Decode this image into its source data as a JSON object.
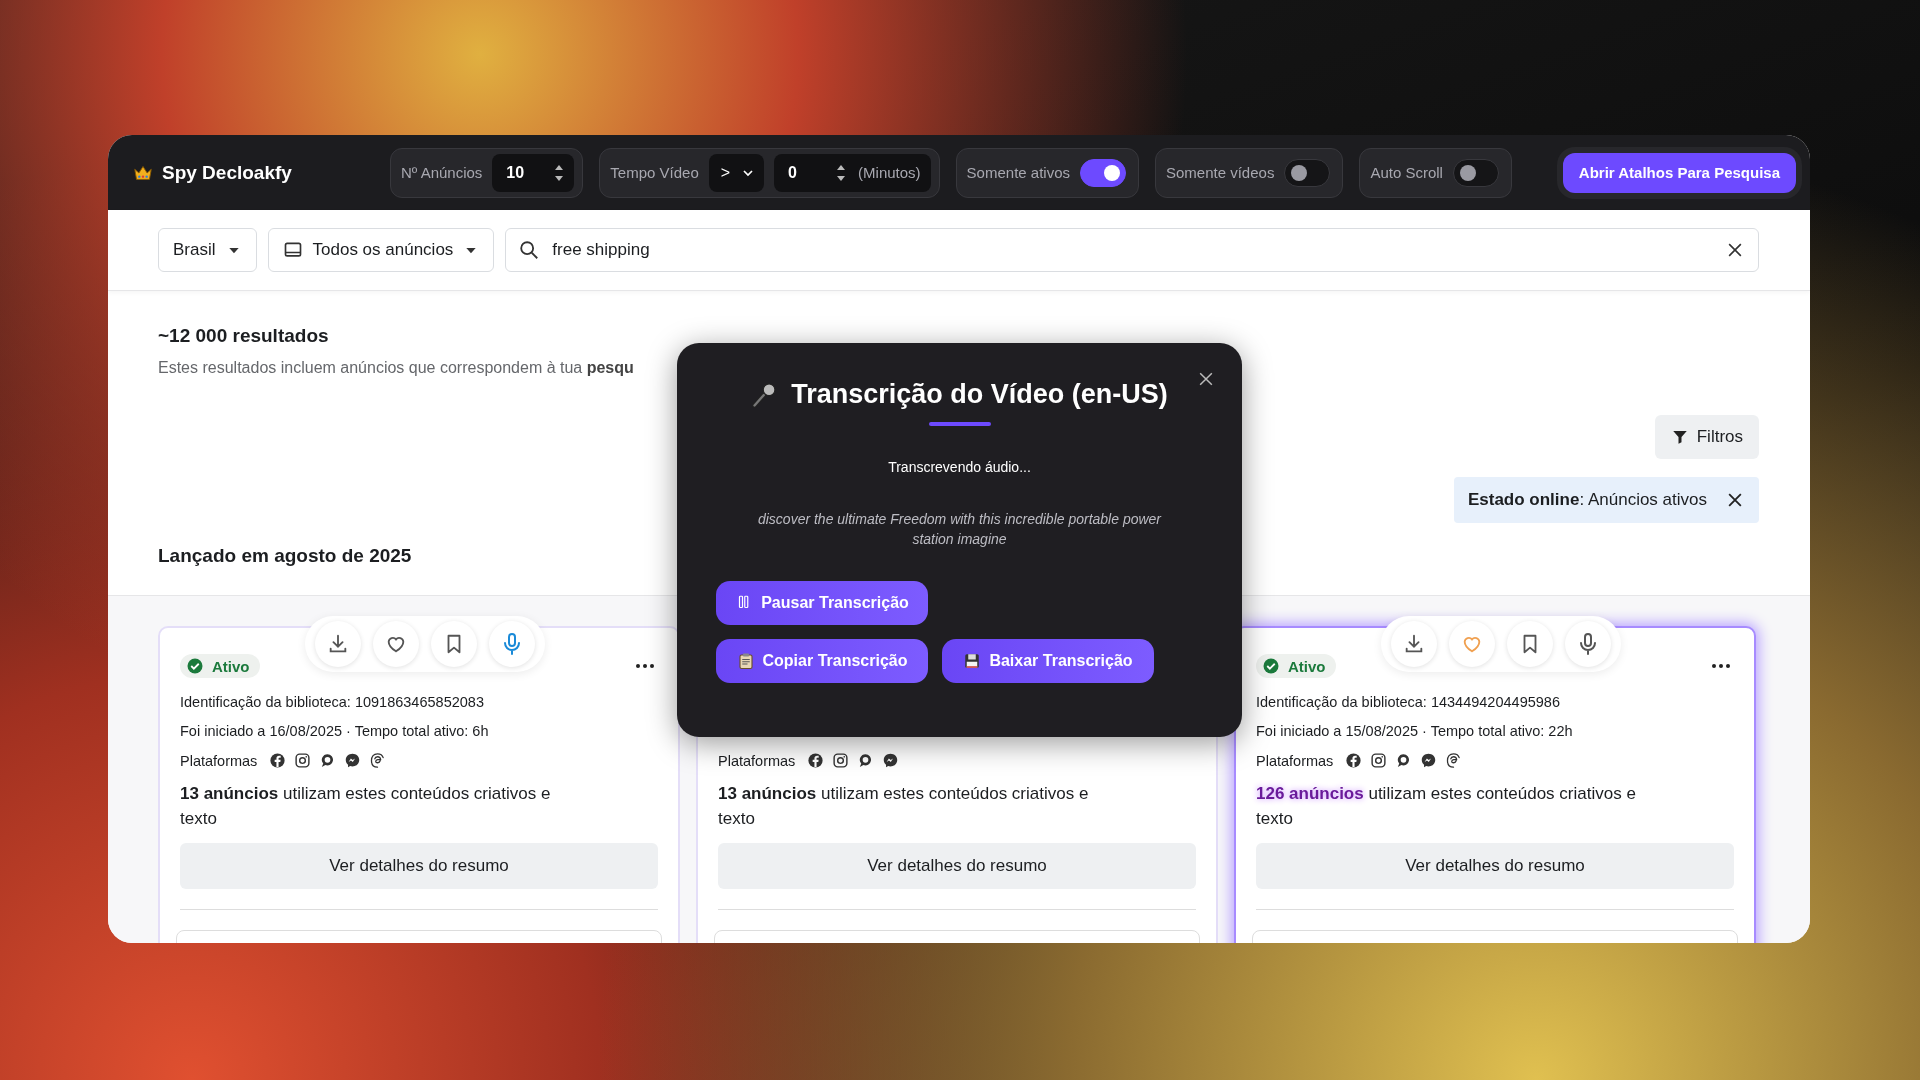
{
  "app": {
    "title": "Spy Decloakfy"
  },
  "toolbar": {
    "ad_count": {
      "label": "Nº Anúncios",
      "value": "10"
    },
    "video_time": {
      "label": "Tempo Vídeo",
      "operator": ">",
      "value": "0",
      "unit": "(Minutos)"
    },
    "toggles": [
      {
        "label": "Somente ativos",
        "on": true
      },
      {
        "label": "Somente vídeos",
        "on": false
      },
      {
        "label": "Auto Scroll",
        "on": false
      }
    ],
    "shortcut_button": "Abrir Atalhos Para Pesquisa"
  },
  "filters": {
    "country": "Brasil",
    "ad_type": "Todos os anúncios",
    "search": {
      "value": "free shipping"
    }
  },
  "results": {
    "count": "~12 000 resultados",
    "description": "Estes resultados incluem anúncios que correspondem à tua **pesqu**",
    "filter_button": "Filtros",
    "active_filter": "**Estado online**: Anúncios ativos",
    "section_title": "Lançado em agosto de 2025"
  },
  "cards": [
    {
      "highlighted": false,
      "status": "Ativo",
      "actions": {
        "liked": false,
        "transcribing": true
      },
      "library_id": "Identificação da biblioteca: 1091863465852083",
      "started": "Foi iniciado a 16/08/2025 · Tempo total ativo: 6h",
      "platforms_label": "Plataformas",
      "platforms": [
        {
          "kind": "facebook"
        },
        {
          "kind": "instagram"
        },
        {
          "kind": "audience"
        },
        {
          "kind": "messenger"
        },
        {
          "kind": "threads"
        }
      ],
      "summary": "**13 anúncios** utilizam estes conteúdos criativos e texto",
      "details_button": "Ver detalhes do resumo"
    },
    {
      "highlighted": false,
      "platforms_label": "Plataformas",
      "platforms": [
        {
          "kind": "facebook"
        },
        {
          "kind": "instagram"
        },
        {
          "kind": "audience"
        },
        {
          "kind": "messenger"
        }
      ],
      "summary": "**13 anúncios** utilizam estes conteúdos criativos e texto",
      "details_button": "Ver detalhes do resumo"
    },
    {
      "highlighted": true,
      "status": "Ativo",
      "actions": {
        "liked": true,
        "transcribing": false
      },
      "library_id": "Identificação da biblioteca: 1434494204495986",
      "started": "Foi iniciado a 15/08/2025 · Tempo total ativo: 22h",
      "platforms_label": "Plataformas",
      "platforms": [
        {
          "kind": "facebook"
        },
        {
          "kind": "instagram"
        },
        {
          "kind": "audience"
        },
        {
          "kind": "messenger"
        },
        {
          "kind": "threads"
        }
      ],
      "summary": "**126 anúncios** utilizam estes conteúdos criativos e texto",
      "details_button": "Ver detalhes do resumo"
    }
  ],
  "modal": {
    "title": "Transcrição do Vídeo (en-US)",
    "status": "Transcrevendo áudio...",
    "transcript": "discover the ultimate Freedom with this incredible portable power station imagine",
    "buttons": [
      {
        "kind": "pause",
        "label": "Pausar Transcrição"
      },
      {
        "kind": "copy",
        "label": "Copiar Transcrição"
      },
      {
        "kind": "download",
        "label": "Baixar Transcrição"
      }
    ]
  }
}
